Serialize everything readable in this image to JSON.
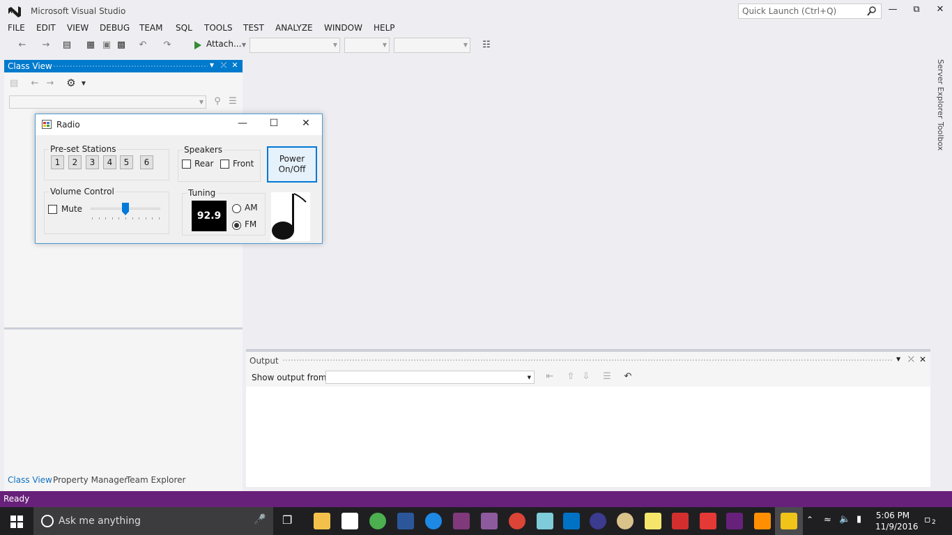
{
  "app": {
    "title": "Microsoft Visual Studio",
    "quick_launch_placeholder": "Quick Launch (Ctrl+Q)"
  },
  "menu": [
    "FILE",
    "EDIT",
    "VIEW",
    "DEBUG",
    "TEAM",
    "SQL",
    "TOOLS",
    "TEST",
    "ANALYZE",
    "WINDOW",
    "HELP"
  ],
  "toolbar": {
    "attach_label": "Attach..."
  },
  "class_view": {
    "title": "Class View",
    "tabs": [
      "Class View",
      "Property Manager",
      "Team Explorer"
    ]
  },
  "radio_form": {
    "title": "Radio",
    "preset_group_label": "Pre-set Stations",
    "presets": [
      "1",
      "2",
      "3",
      "4",
      "5",
      "6"
    ],
    "speakers_group_label": "Speakers",
    "speaker_rear_label": "Rear",
    "speaker_front_label": "Front",
    "power_label_line1": "Power",
    "power_label_line2": "On/Off",
    "volume_group_label": "Volume Control",
    "mute_label": "Mute",
    "volume_level": 0.5,
    "tuning_group_label": "Tuning",
    "frequency": "92.9",
    "am_label": "AM",
    "fm_label": "FM",
    "selected_band": "FM"
  },
  "output": {
    "title": "Output",
    "show_from_label": "Show output from:"
  },
  "side_tabs": [
    "Server Explorer",
    "Toolbox"
  ],
  "status": {
    "text": "Ready",
    "bar_color": "#68217a"
  },
  "taskbar": {
    "search_placeholder": "Ask me anything",
    "time": "5:06 PM",
    "date": "11/9/2016",
    "notification_count": "2"
  }
}
